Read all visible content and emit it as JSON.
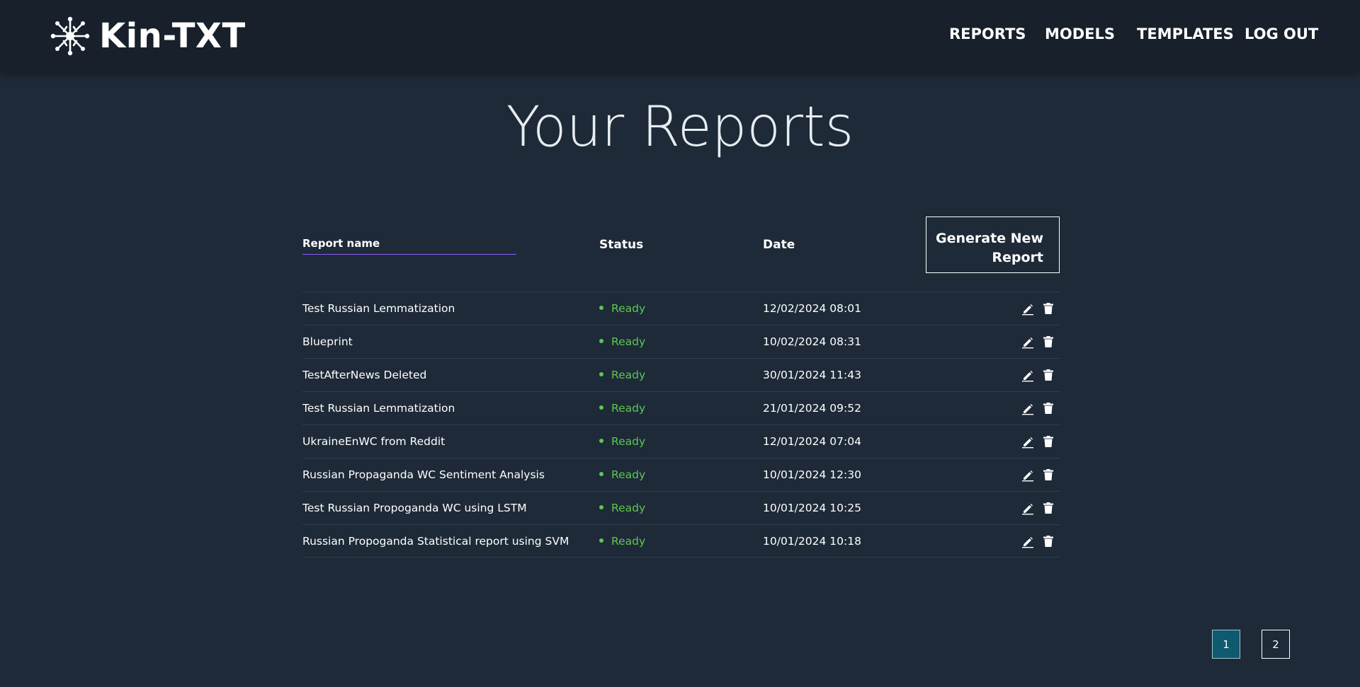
{
  "brand": {
    "name": "Kin-TXT"
  },
  "nav": {
    "reports": "REPORTS",
    "models": "MODELS",
    "templates": "TEMPLATES",
    "logout": "LOG OUT"
  },
  "page": {
    "title": "Your Reports"
  },
  "table": {
    "headers": {
      "name_placeholder": "Report name",
      "status": "Status",
      "date": "Date"
    },
    "generate_button": {
      "line1": "Generate New",
      "line2": "Report"
    },
    "rows": [
      {
        "name": "Test Russian Lemmatization",
        "status": "Ready",
        "date": "12/02/2024 08:01"
      },
      {
        "name": "Blueprint",
        "status": "Ready",
        "date": "10/02/2024 08:31"
      },
      {
        "name": "TestAfterNews Deleted",
        "status": "Ready",
        "date": "30/01/2024 11:43"
      },
      {
        "name": "Test Russian Lemmatization",
        "status": "Ready",
        "date": "21/01/2024 09:52"
      },
      {
        "name": "UkraineEnWC from Reddit",
        "status": "Ready",
        "date": "12/01/2024 07:04"
      },
      {
        "name": "Russian Propaganda WC Sentiment Analysis",
        "status": "Ready",
        "date": "10/01/2024 12:30"
      },
      {
        "name": "Test Russian Propoganda WC using LSTM",
        "status": "Ready",
        "date": "10/01/2024 10:25"
      },
      {
        "name": "Russian Propoganda Statistical report using SVM",
        "status": "Ready",
        "date": "10/01/2024 10:18"
      }
    ]
  },
  "pagination": {
    "pages": [
      "1",
      "2"
    ],
    "current": "1"
  },
  "colors": {
    "background": "#1e2a38",
    "header": "#17202b",
    "status_ready": "#5ec751",
    "search_underline": "#8b5cf6",
    "active_page": "#0e5a6f"
  },
  "icons": {
    "brand": "neuron-icon",
    "edit": "pencil-icon",
    "delete": "trash-icon"
  }
}
